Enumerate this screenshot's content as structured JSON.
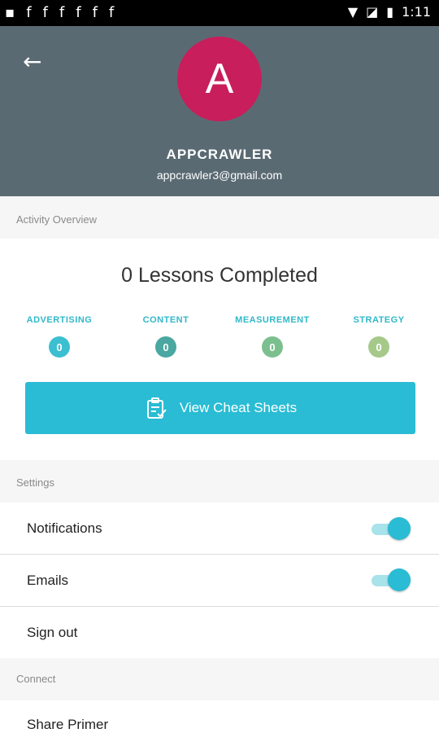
{
  "status_bar": {
    "time": "1:11",
    "notification_icons": [
      "notification-icon",
      "facebook-icon",
      "facebook-icon",
      "facebook-icon",
      "facebook-icon",
      "facebook-icon",
      "facebook-icon"
    ]
  },
  "header": {
    "avatar_letter": "A",
    "app_name": "APPCRAWLER",
    "email": "appcrawler3@gmail.com"
  },
  "activity": {
    "section_title": "Activity Overview",
    "lessons_completed": "0 Lessons Completed",
    "categories": [
      {
        "label": "ADVERTISING",
        "count": "0",
        "color": "#3bbfd1"
      },
      {
        "label": "CONTENT",
        "count": "0",
        "color": "#4aa7a1"
      },
      {
        "label": "MEASUREMENT",
        "count": "0",
        "color": "#7cbf8f"
      },
      {
        "label": "STRATEGY",
        "count": "0",
        "color": "#a6c98a"
      }
    ],
    "cheat_sheet_button": "View Cheat Sheets"
  },
  "settings": {
    "section_title": "Settings",
    "notifications_label": "Notifications",
    "notifications_on": true,
    "emails_label": "Emails",
    "emails_on": true,
    "sign_out_label": "Sign out"
  },
  "connect": {
    "section_title": "Connect",
    "share_label": "Share Primer"
  }
}
